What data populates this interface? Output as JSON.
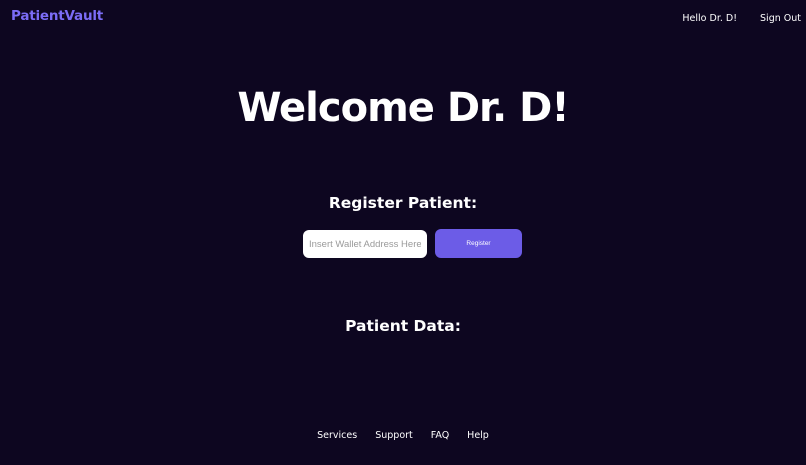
{
  "header": {
    "brand": "PatientVault",
    "greeting": "Hello Dr. D!",
    "sign_out": "Sign Out"
  },
  "main": {
    "welcome": "Welcome Dr. D!",
    "register_title": "Register Patient:",
    "wallet_placeholder": "Insert Wallet Address Here",
    "register_button": "Register",
    "patient_data_title": "Patient Data:"
  },
  "footer": {
    "links": [
      "Services",
      "Support",
      "FAQ",
      "Help"
    ]
  },
  "colors": {
    "background": "#0d0620",
    "brand": "#7b6cf6",
    "button": "#6c5ce7"
  }
}
